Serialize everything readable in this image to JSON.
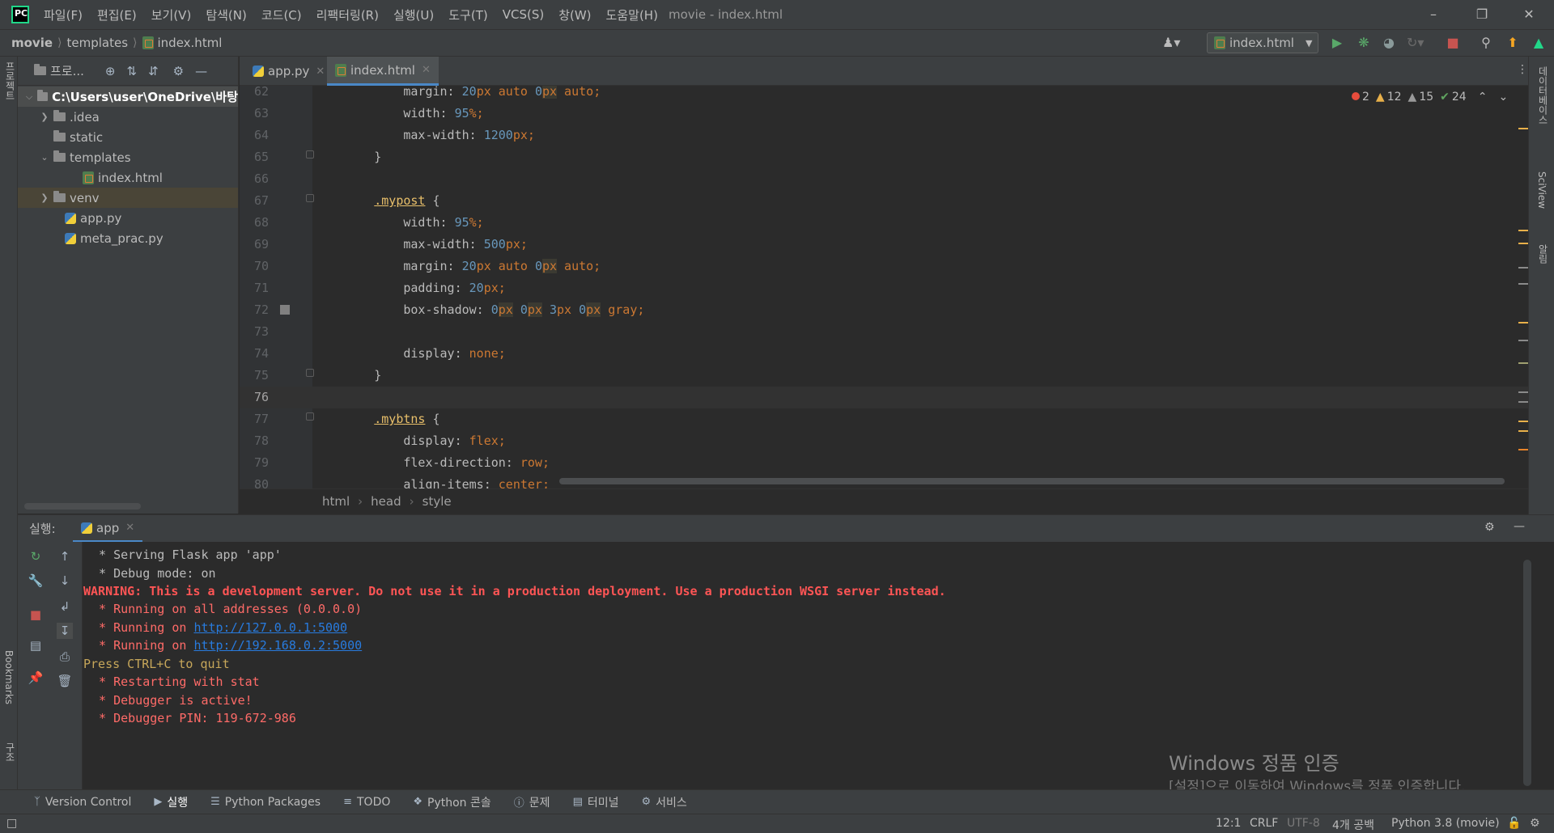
{
  "menu": {
    "items": [
      "파일(F)",
      "편집(E)",
      "보기(V)",
      "탐색(N)",
      "코드(C)",
      "리팩터링(R)",
      "실행(U)",
      "도구(T)",
      "VCS(S)",
      "창(W)",
      "도움말(H)"
    ],
    "window_title": "movie - index.html",
    "logo_text": "PC"
  },
  "nav": {
    "crumbs": [
      "movie",
      "templates",
      "index.html"
    ],
    "run_config": "index.html"
  },
  "project": {
    "header_label": "프로...",
    "root": "C:\\Users\\user\\OneDrive\\바탕",
    "items": [
      {
        "label": ".idea"
      },
      {
        "label": "static"
      },
      {
        "label": "templates"
      },
      {
        "label": "index.html"
      },
      {
        "label": "venv"
      },
      {
        "label": "app.py"
      },
      {
        "label": "meta_prac.py"
      }
    ]
  },
  "left_strip": {
    "project": "프로젝트",
    "bookmarks": "Bookmarks",
    "structure": "구조"
  },
  "right_strip": {
    "database": "데이터베이스",
    "sciview": "SciView",
    "notifications": "알림"
  },
  "editor": {
    "tabs": [
      {
        "label": "app.py"
      },
      {
        "label": "index.html"
      }
    ],
    "inspections": {
      "errors": "2",
      "warnings": "12",
      "weak_warnings": "15",
      "ok": "24"
    },
    "breadcrumbs": [
      "html",
      "head",
      "style"
    ],
    "lines": [
      {
        "n": "62",
        "t": "            margin: 20px auto 0px auto;"
      },
      {
        "n": "63",
        "t": "            width: 95%;"
      },
      {
        "n": "64",
        "t": "            max-width: 1200px;"
      },
      {
        "n": "65",
        "t": "        }"
      },
      {
        "n": "66",
        "t": ""
      },
      {
        "n": "67",
        "t": "        .mypost {"
      },
      {
        "n": "68",
        "t": "            width: 95%;"
      },
      {
        "n": "69",
        "t": "            max-width: 500px;"
      },
      {
        "n": "70",
        "t": "            margin: 20px auto 0px auto;"
      },
      {
        "n": "71",
        "t": "            padding: 20px;"
      },
      {
        "n": "72",
        "t": "            box-shadow: 0px 0px 3px 0px gray;"
      },
      {
        "n": "73",
        "t": ""
      },
      {
        "n": "74",
        "t": "            display: none;"
      },
      {
        "n": "75",
        "t": "        }"
      },
      {
        "n": "76",
        "t": ""
      },
      {
        "n": "77",
        "t": "        .mybtns {"
      },
      {
        "n": "78",
        "t": "            display: flex;"
      },
      {
        "n": "79",
        "t": "            flex-direction: row;"
      },
      {
        "n": "80",
        "t": "            align-items: center;"
      }
    ]
  },
  "run": {
    "label": "실행:",
    "tab": "app",
    "console": [
      {
        "text": " * Serving Flask app 'app'",
        "style": "def"
      },
      {
        "text": " * Debug mode: on",
        "style": "def"
      },
      {
        "text": "WARNING: This is a development server. Do not use it in a production deployment. Use a production WSGI server instead.",
        "style": "redb"
      },
      {
        "text": " * Running on all addresses (0.0.0.0)",
        "style": "red"
      },
      {
        "text": " * Running on ",
        "link": "http://127.0.0.1:5000",
        "style": "red"
      },
      {
        "text": " * Running on ",
        "link": "http://192.168.0.2:5000",
        "style": "red"
      },
      {
        "text": "Press CTRL+C to quit",
        "style": "yel"
      },
      {
        "text": " * Restarting with stat",
        "style": "red"
      },
      {
        "text": " * Debugger is active!",
        "style": "red"
      },
      {
        "text": " * Debugger PIN: 119-672-986",
        "style": "red"
      }
    ]
  },
  "watermark": {
    "line1": "Windows 정품 인증",
    "line2": "[설정]으로 이동하여 Windows를 정품 인증합니다."
  },
  "bottom_tools": [
    "Version Control",
    "실행",
    "Python Packages",
    "TODO",
    "Python 콘솔",
    "문제",
    "터미널",
    "서비스"
  ],
  "status": {
    "position": "12:1",
    "line_sep": "CRLF",
    "encoding": "UTF-8",
    "indent": "4개 공백",
    "interpreter": "Python 3.8 (movie)"
  },
  "colors": {
    "accent": "#4a88c7",
    "error": "#ff6b68",
    "link": "#287bde"
  }
}
